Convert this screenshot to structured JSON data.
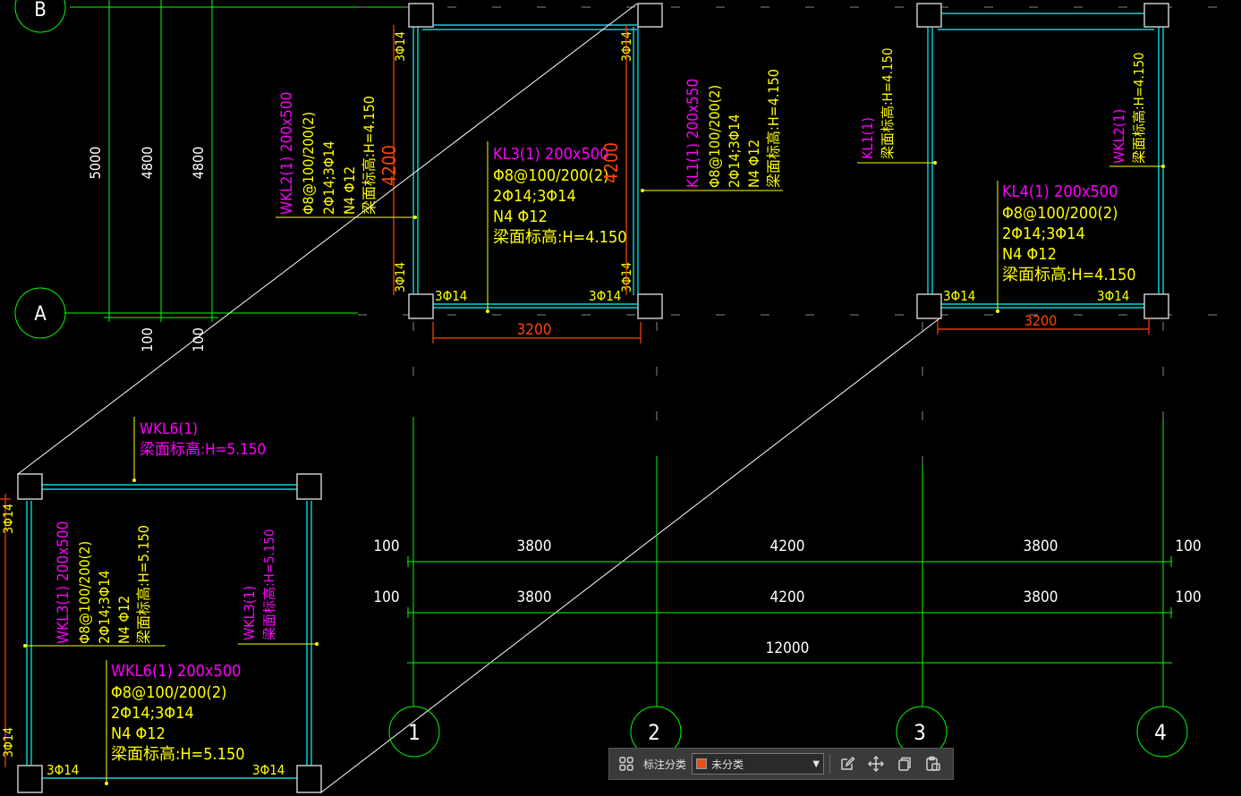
{
  "grid": {
    "bubbles": {
      "b": "B",
      "a": "A",
      "n1": "1",
      "n2": "2",
      "n3": "3",
      "n4": "4"
    }
  },
  "dimensions": {
    "top_left": {
      "d5000": "5000",
      "d4800a": "4800",
      "d4800b": "4800",
      "d100a": "100",
      "d100b": "100"
    },
    "span_kl3": "3200",
    "span_kl4": "3200",
    "height_left": "4200",
    "height_right": "4200",
    "row1": [
      "100",
      "3800",
      "4200",
      "3800",
      "100"
    ],
    "row2": [
      "100",
      "3800",
      "4200",
      "3800",
      "100"
    ],
    "total": "12000"
  },
  "beams": {
    "wkl2_left": {
      "name": "WKL2(1) 200x500",
      "stirrup": "Φ8@100/200(2)",
      "bars": "2Φ14;3Φ14",
      "waist": "N4 Φ12",
      "elev": "梁面标高:H=4.150"
    },
    "kl3": {
      "name": "KL3(1) 200x500",
      "stirrup": "Φ8@100/200(2)",
      "bars": "2Φ14;3Φ14",
      "waist": "N4 Φ12",
      "elev": "梁面标高:H=4.150"
    },
    "kl1_mid": {
      "name": "KL1(1) 200x550",
      "stirrup": "Φ8@100/200(2)",
      "bars": "2Φ14;3Φ14",
      "waist": "N4 Φ12",
      "elev": "梁面标高:H=4.150"
    },
    "kl1_right": {
      "name": "KL1(1)",
      "elev": "梁面标高:H=4.150"
    },
    "wkl2_right": {
      "name": "WKL2(1)",
      "elev": "梁面标高:H=4.150"
    },
    "kl4": {
      "name": "KL4(1) 200x500",
      "stirrup": "Φ8@100/200(2)",
      "bars": "2Φ14;3Φ14",
      "waist": "N4 Φ12",
      "elev": "梁面标高:H=4.150"
    },
    "wkl6_top": {
      "name": "WKL6(1)",
      "elev": "梁面标高:H=5.150"
    },
    "wkl3_left": {
      "name": "WKL3(1) 200x500",
      "stirrup": "Φ8@100/200(2)",
      "bars": "2Φ14;3Φ14",
      "waist": "N4 Φ12",
      "elev": "梁面标高:H=5.150"
    },
    "wkl3_right": {
      "name": "WKL3(1)",
      "elev": "梁面标高:H=5.150"
    },
    "wkl6_bottom": {
      "name": "WKL6(1) 200x500",
      "stirrup": "Φ8@100/200(2)",
      "bars": "2Φ14;3Φ14",
      "waist": "N4 Φ12",
      "elev": "梁面标高:H=5.150"
    }
  },
  "rebar_tags": {
    "three_phi14": "3Φ14"
  },
  "colors": {
    "background": "#000000",
    "grid_green": "#00ff00",
    "beam_cyan": "#00ffff",
    "column_gray": "#c8c8c8",
    "text_yellow": "#ffff00",
    "text_magenta": "#ff00ff",
    "dim_orange": "#ff4500",
    "dim_text_white": "#ffffff"
  },
  "toolbar": {
    "category_label": "标注分类",
    "category_value": "未分类",
    "category_color": "#e8501a",
    "icons": [
      "grid-view-icon",
      "edit-icon",
      "move-icon",
      "copy-icon",
      "paste-icon"
    ]
  }
}
